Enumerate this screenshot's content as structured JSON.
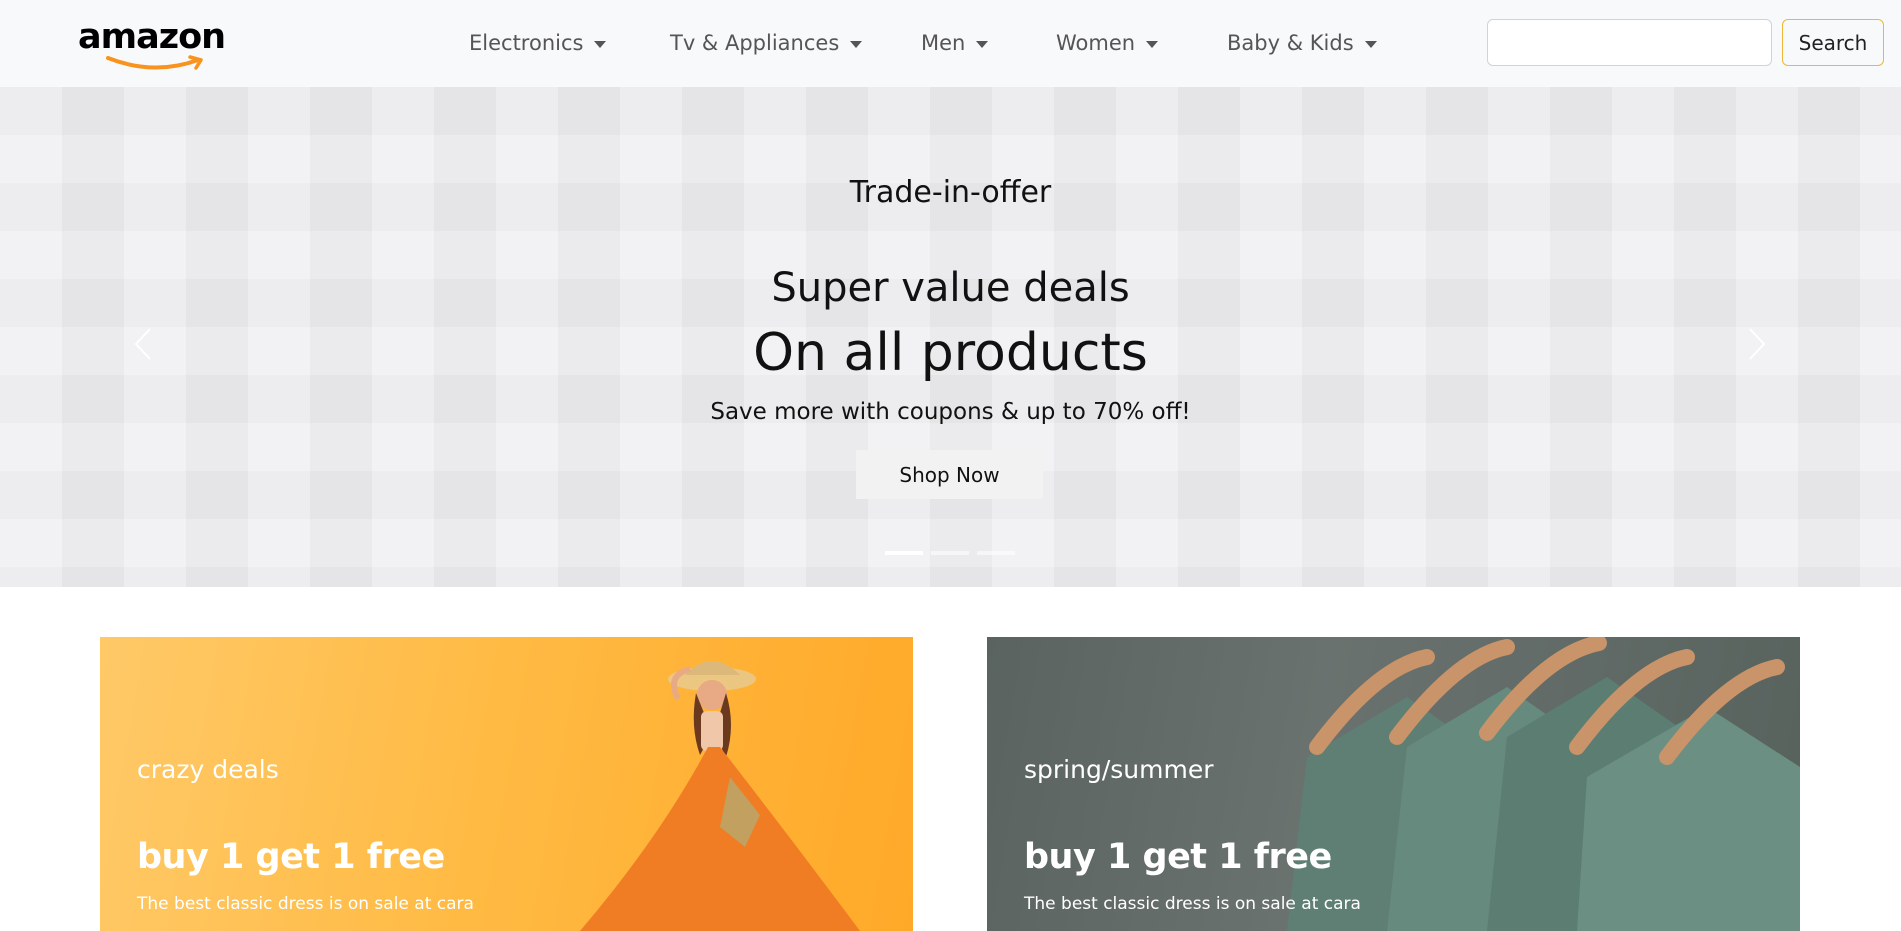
{
  "brand": {
    "name": "amazon"
  },
  "nav": {
    "items": [
      {
        "label": "Electronics"
      },
      {
        "label": "Tv & Appliances"
      },
      {
        "label": "Men"
      },
      {
        "label": "Women"
      },
      {
        "label": "Baby & Kids"
      }
    ],
    "search": {
      "value": "",
      "placeholder": "",
      "button_label": "Search"
    }
  },
  "hero": {
    "kicker": "Trade-in-offer",
    "heading": "Super value deals",
    "title": "On all products",
    "subtitle": "Save more with coupons & up to 70% off!",
    "cta_label": "Shop Now",
    "slides_count": 3,
    "active_slide": 1
  },
  "banners": [
    {
      "kicker": "crazy deals",
      "title": "buy 1 get 1 free",
      "description": "The best classic dress is on sale at cara"
    },
    {
      "kicker": "spring/summer",
      "title": "buy 1 get 1 free",
      "description": "The best classic dress is on sale at cara"
    }
  ],
  "colors": {
    "accent": "#f0b63a",
    "navbar_bg": "#f8f9fa",
    "hero_bg": "#ececee",
    "banner_left": "#ffbb45",
    "banner_right": "#5a6360",
    "logo_smile": "#f7931e"
  }
}
